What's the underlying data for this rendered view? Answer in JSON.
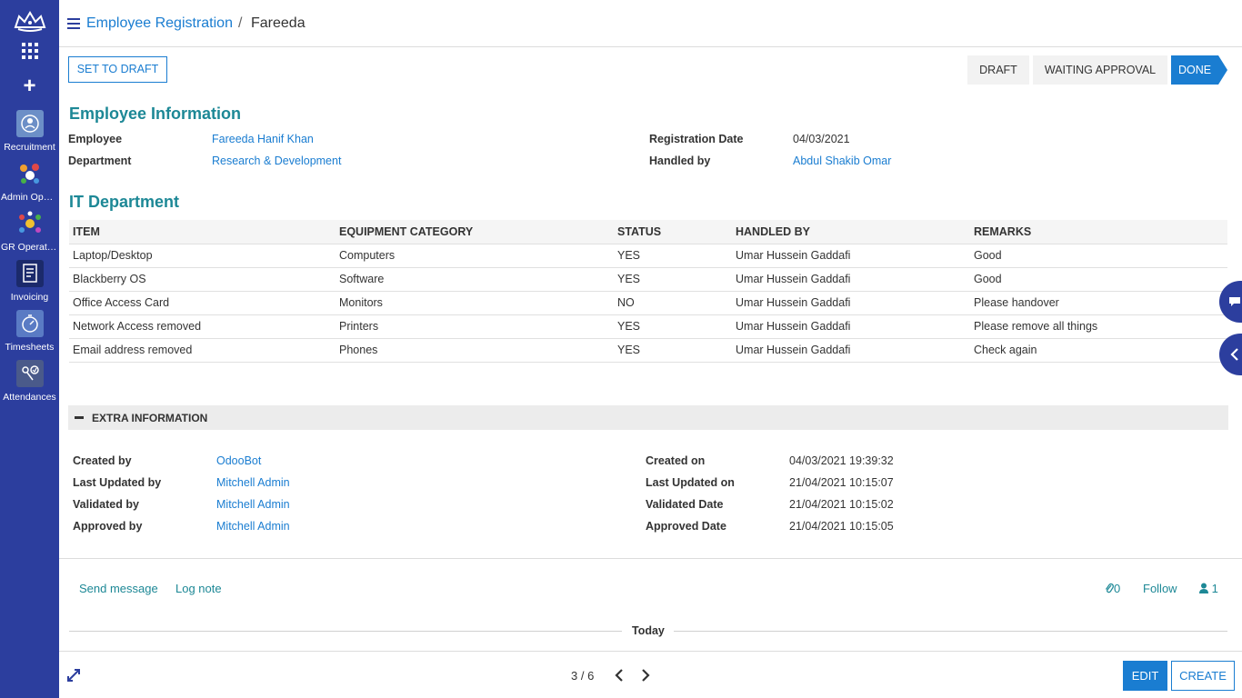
{
  "sidebar": {
    "logo_icon": "crown-logo-icon",
    "apps_icon": "grid-icon",
    "add_icon": "+",
    "apps": [
      {
        "label": "Recruitment",
        "icon": "recruitment-icon",
        "color": "#6c8fc7"
      },
      {
        "label": "Admin Oper...",
        "icon": "admin-operations-icon",
        "color": "#ffffff"
      },
      {
        "label": "GR Operatio...",
        "icon": "gr-operations-icon",
        "color": "#ffffff"
      },
      {
        "label": "Invoicing",
        "icon": "invoicing-icon",
        "color": "#1b2a6b"
      },
      {
        "label": "Timesheets",
        "icon": "timesheets-icon",
        "color": "#5a7bc4"
      },
      {
        "label": "Attendances",
        "icon": "attendances-icon",
        "color": "#4a5a8a"
      }
    ]
  },
  "breadcrumb": {
    "parent": "Employee Registration",
    "separator": "/",
    "current": "Fareeda"
  },
  "actions": {
    "set_to_draft": "SET TO DRAFT"
  },
  "status": {
    "stages": [
      "DRAFT",
      "WAITING APPROVAL",
      "DONE"
    ],
    "active": "DONE"
  },
  "employee_info": {
    "title": "Employee Information",
    "employee_label": "Employee",
    "employee_value": "Fareeda Hanif Khan",
    "department_label": "Department",
    "department_value": "Research & Development",
    "reg_date_label": "Registration Date",
    "reg_date_value": "04/03/2021",
    "handled_by_label": "Handled by",
    "handled_by_value": "Abdul Shakib Omar"
  },
  "it_department": {
    "title": "IT Department",
    "columns": [
      "ITEM",
      "EQUIPMENT CATEGORY",
      "STATUS",
      "HANDLED BY",
      "REMARKS"
    ],
    "rows": [
      [
        "Laptop/Desktop",
        "Computers",
        "YES",
        "Umar Hussein Gaddafi",
        "Good"
      ],
      [
        "Blackberry OS",
        "Software",
        "YES",
        "Umar Hussein Gaddafi",
        "Good"
      ],
      [
        "Office Access Card",
        "Monitors",
        "NO",
        "Umar Hussein Gaddafi",
        "Please handover"
      ],
      [
        "Network Access removed",
        "Printers",
        "YES",
        "Umar Hussein Gaddafi",
        "Please remove all things"
      ],
      [
        "Email address removed",
        "Phones",
        "YES",
        "Umar Hussein Gaddafi",
        "Check again"
      ]
    ]
  },
  "extra_info": {
    "title": "EXTRA INFORMATION",
    "created_by_label": "Created by",
    "created_by_value": "OdooBot",
    "last_updated_by_label": "Last Updated by",
    "last_updated_by_value": "Mitchell Admin",
    "validated_by_label": "Validated by",
    "validated_by_value": "Mitchell Admin",
    "approved_by_label": "Approved by",
    "approved_by_value": "Mitchell Admin",
    "created_on_label": "Created on",
    "created_on_value": "04/03/2021 19:39:32",
    "last_updated_on_label": "Last Updated on",
    "last_updated_on_value": "21/04/2021 10:15:07",
    "validated_date_label": "Validated Date",
    "validated_date_value": "21/04/2021 10:15:02",
    "approved_date_label": "Approved Date",
    "approved_date_value": "21/04/2021 10:15:05"
  },
  "chatter": {
    "send_message": "Send message",
    "log_note": "Log note",
    "attachments_count": "0",
    "follow": "Follow",
    "followers_count": "1",
    "today": "Today"
  },
  "pager": {
    "value": "3 / 6"
  },
  "footer": {
    "edit": "EDIT",
    "create": "CREATE"
  },
  "colors": {
    "sidebar": "#2c3e9e",
    "accent": "#1a7dd1",
    "section_title": "#1d8896"
  }
}
